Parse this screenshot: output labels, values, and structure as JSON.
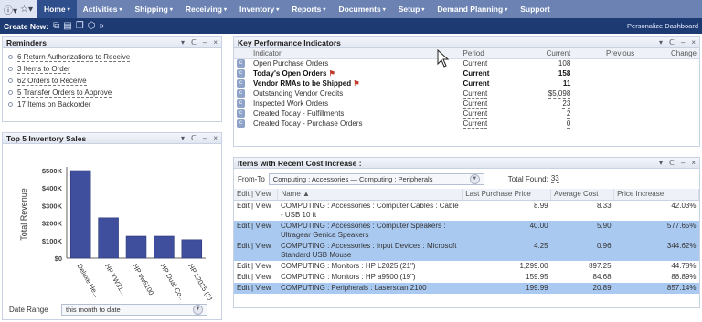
{
  "nav": {
    "ctl_icons": [
      "info-icon",
      "star-icon"
    ],
    "tabs": [
      "Home",
      "Activities",
      "Shipping",
      "Receiving",
      "Inventory",
      "Reports",
      "Documents",
      "Setup",
      "Demand Planning",
      "Support"
    ]
  },
  "createbar": {
    "label": "Create New:",
    "icons": [
      "new-order-icon",
      "new-document-icon",
      "new-copy-icon",
      "new-item-icon"
    ],
    "more": "»",
    "personalize": "Personalize Dashboard"
  },
  "reminders": {
    "title": "Reminders",
    "items": [
      "6 Return Authorizations to Receive",
      "3 Items to Order",
      "62 Orders to Receive",
      "5 Transfer Orders to Approve",
      "17 Items on Backorder"
    ]
  },
  "sales": {
    "title": "Top 5 Inventory Sales",
    "date_range_label": "Date Range",
    "date_range_value": "this month to date"
  },
  "chart_data": {
    "type": "bar",
    "title": "Top 5 Inventory Sales",
    "xlabel": "",
    "ylabel": "Total Revenue",
    "categories": [
      "Deluxe He...",
      "HP YW31...",
      "HP vw6100",
      "HP Dual-Co...",
      "HP L2025 (21"
    ],
    "values": [
      500000,
      230000,
      125000,
      125000,
      105000
    ],
    "y_ticks": [
      "$0",
      "$100K",
      "$200K",
      "$300K",
      "$400K",
      "$500K"
    ],
    "ylim": [
      0,
      500000
    ],
    "bar_color": "#3f4f9e",
    "grid": false
  },
  "kpi": {
    "title": "Key Performance Indicators",
    "columns": [
      "Indicator",
      "Period",
      "Current",
      "Previous",
      "Change"
    ],
    "rows": [
      {
        "indicator": "Open Purchase Orders",
        "period": "Current",
        "current": "108",
        "bold": false,
        "flag": false
      },
      {
        "indicator": "Today's Open Orders",
        "period": "Current",
        "current": "158",
        "bold": true,
        "flag": true
      },
      {
        "indicator": "Vendor RMAs to be Shipped",
        "period": "Current",
        "current": "11",
        "bold": true,
        "flag": true
      },
      {
        "indicator": "Outstanding Vendor Credits",
        "period": "Current",
        "current": "$5,098",
        "bold": false,
        "flag": false
      },
      {
        "indicator": "Inspected Work Orders",
        "period": "Current",
        "current": "23",
        "bold": false,
        "flag": false
      },
      {
        "indicator": "Created Today - Fulfillments",
        "period": "Current",
        "current": "2",
        "bold": false,
        "flag": false
      },
      {
        "indicator": "Created Today - Purchase Orders",
        "period": "Current",
        "current": "0",
        "bold": false,
        "flag": false
      }
    ]
  },
  "cost": {
    "title": "Items with Recent Cost Increase :",
    "from_to_label": "From-To",
    "from_to_value": "Computing : Accessories — Computing : Peripherals",
    "total_found_label": "Total Found:",
    "total_found": "33",
    "columns": [
      "Edit | View",
      "Name ▲",
      "Last Purchase Price",
      "Average Cost",
      "Price Increase"
    ],
    "edit": "Edit",
    "view": "View",
    "rows": [
      {
        "name": "COMPUTING : Accessories : Computer Cables : Cable - USB 10 ft",
        "last": "8.99",
        "avg": "8.33",
        "inc": "42.03%",
        "hl": false
      },
      {
        "name": "COMPUTING : Accessories : Computer Speakers : Ultragear Genica Speakers",
        "last": "40.00",
        "avg": "5.90",
        "inc": "577.65%",
        "hl": true
      },
      {
        "name": "COMPUTING : Accessories : Input Devices : Microsoft Standard USB Mouse",
        "last": "4.25",
        "avg": "0.96",
        "inc": "344.62%",
        "hl": true
      },
      {
        "name": "COMPUTING : Monitors : HP L2025 (21\")",
        "last": "1,299.00",
        "avg": "897.25",
        "inc": "44.78%",
        "hl": false
      },
      {
        "name": "COMPUTING : Monitors : HP a9500 (19\")",
        "last": "159.95",
        "avg": "84.68",
        "inc": "88.89%",
        "hl": false
      },
      {
        "name": "COMPUTING : Peripherals : Laserscan 2100",
        "last": "199.99",
        "avg": "20.89",
        "inc": "857.14%",
        "hl": true
      }
    ]
  },
  "portlet_tools": [
    "▾",
    "ᑕ",
    "–",
    "×"
  ]
}
